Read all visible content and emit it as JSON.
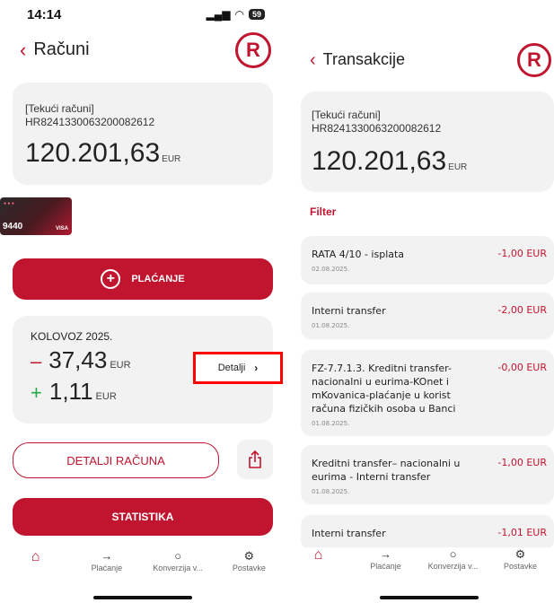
{
  "left": {
    "status": {
      "time": "14:14",
      "battery": "59"
    },
    "title": "Računi",
    "logo_letter": "R",
    "account": {
      "name": "[Tekući računi]",
      "iban": "HR8241330063200082612",
      "balance": "120.201,63",
      "currency": "EUR"
    },
    "card": {
      "number": "9440",
      "network": "VISA"
    },
    "pay_button": "PLAĆANJE",
    "summary": {
      "month": "KOLOVOZ 2025.",
      "outgoing": "37,43",
      "incoming": "1,11",
      "currency": "EUR",
      "details_label": "Detalji"
    },
    "account_details_button": "DETALJI RAČUNA",
    "statistics_button": "STATISTIKA"
  },
  "right": {
    "title": "Transakcije",
    "logo_letter": "R",
    "account": {
      "name": "[Tekući računi]",
      "iban": "HR8241330063200082612",
      "balance": "120.201,63",
      "currency": "EUR"
    },
    "filter_label": "Filter",
    "transactions": [
      {
        "description": "RATA 4/10 - isplata",
        "date": "02.08.2025.",
        "amount": "-1,00 EUR"
      },
      {
        "description": "Interni transfer",
        "date": "01.08.2025.",
        "amount": "-2,00 EUR"
      },
      {
        "description": "FZ-7.7.1.3. Kreditni transfer-nacionalni u eurima-KOnet i mKovanica-plaćanje u korist računa fizičkih osoba u Banci",
        "date": "01.08.2025.",
        "amount": "-0,00 EUR"
      },
      {
        "description": "Kreditni transfer– nacionalni u eurima - Interni transfer",
        "date": "01.08.2025.",
        "amount": "-1,00 EUR"
      },
      {
        "description": "Interni transfer",
        "date": "",
        "amount": "-1,01 EUR"
      }
    ]
  },
  "tabbar": {
    "items": [
      {
        "label": "",
        "icon": "home-icon"
      },
      {
        "label": "Plaćanje",
        "icon": "arrow-right-icon"
      },
      {
        "label": "Konverzija v...",
        "icon": "refresh-icon"
      },
      {
        "label": "Postavke",
        "icon": "gear-icon"
      }
    ]
  },
  "colors": {
    "accent": "#c1152f",
    "card_bg": "#f2f2f2",
    "positive": "#28a745",
    "highlight": "#ff0000"
  }
}
